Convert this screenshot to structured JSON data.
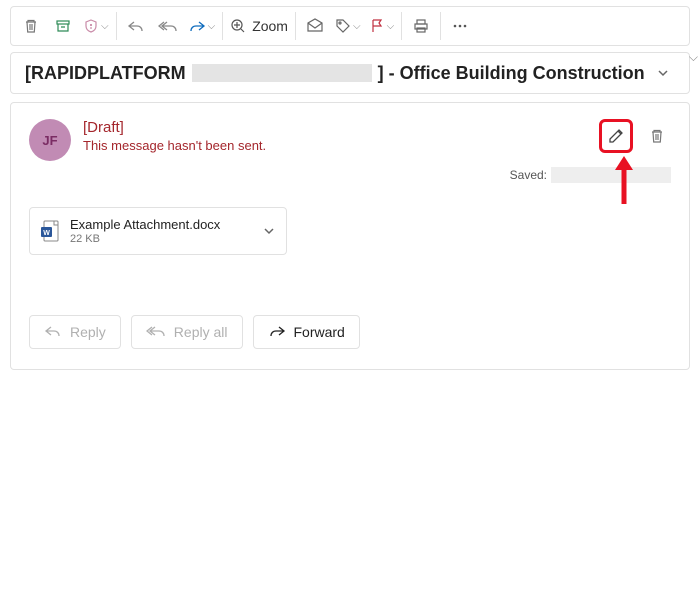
{
  "toolbar": {
    "zoom_label": "Zoom"
  },
  "subject": {
    "prefix": "[RAPIDPLATFORM",
    "suffix": "] - Office Building Construction"
  },
  "message": {
    "avatar_initials": "JF",
    "draft_label": "[Draft]",
    "draft_message": "This message hasn't been sent.",
    "saved_label": "Saved:"
  },
  "attachment": {
    "name": "Example Attachment.docx",
    "size": "22 KB"
  },
  "actions": {
    "reply": "Reply",
    "reply_all": "Reply all",
    "forward": "Forward"
  }
}
